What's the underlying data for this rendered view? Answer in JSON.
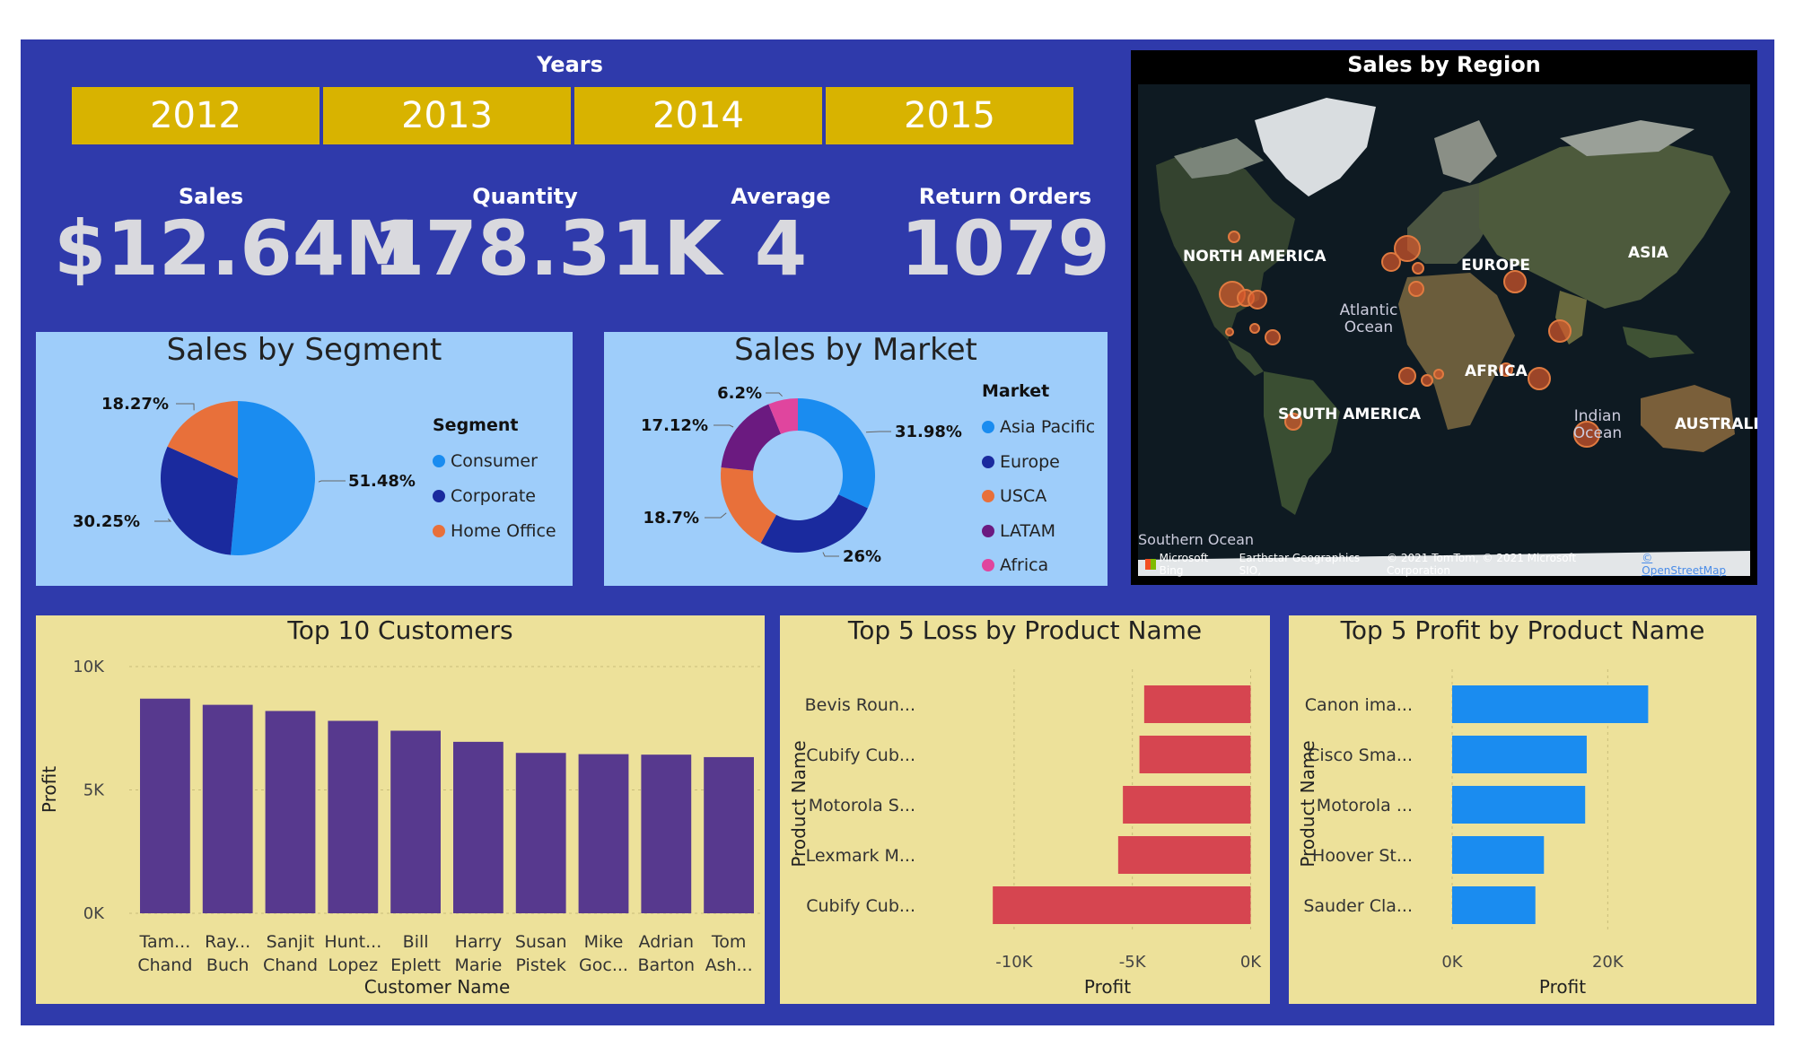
{
  "years": {
    "title": "Years",
    "options": [
      "2012",
      "2013",
      "2014",
      "2015"
    ]
  },
  "kpis": [
    {
      "label": "Sales",
      "value": "$12.64M"
    },
    {
      "label": "Quantity",
      "value": "178.31K"
    },
    {
      "label": "Average",
      "value": "4"
    },
    {
      "label": "Return Orders",
      "value": "1079"
    }
  ],
  "colors": {
    "background": "#2f3aab",
    "slicer": "#d8b300",
    "panel_blue": "#9ecdfa",
    "panel_sand": "#ede19a",
    "purple_bar": "#57398e",
    "loss_bar": "#d64550",
    "profit_bar": "#1a8cf0"
  },
  "map": {
    "title": "Sales by Region",
    "labels": [
      "NORTH AMERICA",
      "Atlantic Ocean",
      "EUROPE",
      "ASIA",
      "AFRICA",
      "SOUTH AMERICA",
      "Indian Ocean",
      "AUSTRALI",
      "Southern Ocean"
    ],
    "attribution": "© 2021 TomTom, © 2021 Microsoft Corporation",
    "brand": "Microsoft Bing",
    "credits": "Earthstar Geographics SIO,",
    "osm": "© OpenStreetMap"
  },
  "chart_data": [
    {
      "type": "pie",
      "title": "Sales by Segment",
      "legend_title": "Segment",
      "categories": [
        "Consumer",
        "Corporate",
        "Home Office"
      ],
      "values": [
        51.48,
        30.25,
        18.27
      ],
      "labels": [
        "51.48%",
        "30.25%",
        "18.27%"
      ],
      "colors": [
        "#1a8cf0",
        "#1a2a9e",
        "#e8703a"
      ],
      "legend_position": "right"
    },
    {
      "type": "pie",
      "subtype": "donut",
      "title": "Sales by Market",
      "legend_title": "Market",
      "categories": [
        "Asia Pacific",
        "Europe",
        "USCA",
        "LATAM",
        "Africa"
      ],
      "values": [
        31.98,
        26,
        18.7,
        17.12,
        6.2
      ],
      "labels": [
        "31.98%",
        "26%",
        "18.7%",
        "17.12%",
        "6.2%"
      ],
      "colors": [
        "#1a8cf0",
        "#1a2a9e",
        "#e8703a",
        "#6b1a80",
        "#e0459e"
      ],
      "legend_position": "right"
    },
    {
      "type": "bar",
      "title": "Top 10 Customers",
      "xlabel": "Customer Name",
      "ylabel": "Profit",
      "categories": [
        [
          "Tam...",
          "Chand"
        ],
        [
          "Ray...",
          "Buch"
        ],
        [
          "Sanjit",
          "Chand"
        ],
        [
          "Hunt...",
          "Lopez"
        ],
        [
          "Bill",
          "Eplett"
        ],
        [
          "Harry",
          "Marie"
        ],
        [
          "Susan",
          "Pistek"
        ],
        [
          "Mike",
          "Goc..."
        ],
        [
          "Adrian",
          "Barton"
        ],
        [
          "Tom",
          "Ash..."
        ]
      ],
      "values": [
        8700,
        8450,
        8200,
        7800,
        7400,
        6950,
        6500,
        6450,
        6430,
        6330
      ],
      "yticks": [
        "0K",
        "5K",
        "10K"
      ],
      "ylim": [
        0,
        10000
      ]
    },
    {
      "type": "bar",
      "orientation": "horizontal",
      "title": "Top 5 Loss by Product Name",
      "xlabel": "Profit",
      "ylabel": "Product Name",
      "categories": [
        "Bevis Roun...",
        "Cubify Cub...",
        "Motorola S...",
        "Lexmark M...",
        "Cubify Cub..."
      ],
      "values": [
        -4500,
        -4700,
        -5400,
        -5600,
        -10900
      ],
      "xticks": [
        "-10K",
        "-5K",
        "0K"
      ],
      "xlim": [
        -12500,
        0
      ]
    },
    {
      "type": "bar",
      "orientation": "horizontal",
      "title": "Top 5 Profit by Product Name",
      "xlabel": "Profit",
      "ylabel": "Product Name",
      "categories": [
        "Canon ima...",
        "Cisco Sma...",
        "Motorola ...",
        "Hoover St...",
        "Sauder Cla..."
      ],
      "values": [
        25200,
        17300,
        17100,
        11800,
        10700
      ],
      "xticks": [
        "0K",
        "20K"
      ],
      "xlim": [
        0,
        33000
      ]
    }
  ]
}
